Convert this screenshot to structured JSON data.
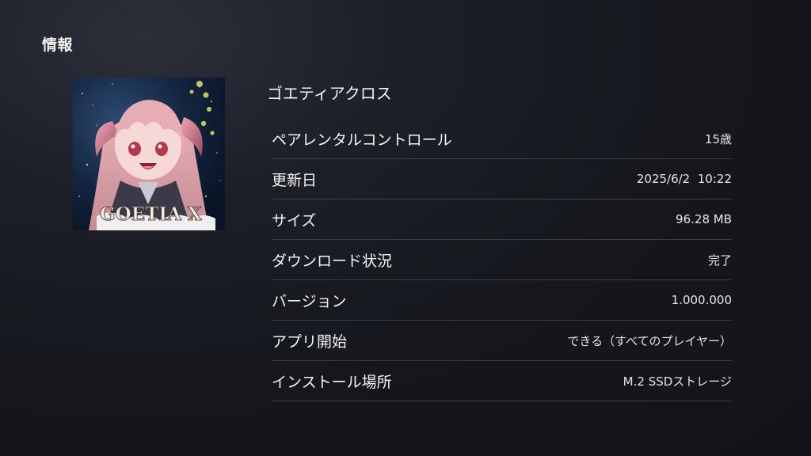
{
  "page": {
    "title": "情報"
  },
  "game": {
    "title": "ゴエティアクロス",
    "thumbnail_icon": "game-cover-art",
    "logo_text": "GOETIA X",
    "logo_subtext": "ゴエティアクロス"
  },
  "info": {
    "rows": [
      {
        "label": "ペアレンタルコントロール",
        "value": "15歳"
      },
      {
        "label": "更新日",
        "value": "2025/6/2  10:22"
      },
      {
        "label": "サイズ",
        "value": "96.28 MB"
      },
      {
        "label": "ダウンロード状況",
        "value": "完了"
      },
      {
        "label": "バージョン",
        "value": "1.000.000"
      },
      {
        "label": "アプリ開始",
        "value": "できる（すべてのプレイヤー）"
      },
      {
        "label": "インストール場所",
        "value": "M.2 SSDストレージ"
      }
    ]
  },
  "colors": {
    "background": "#16181e",
    "divider": "#3a3d45",
    "text": "#f2f2f2"
  }
}
